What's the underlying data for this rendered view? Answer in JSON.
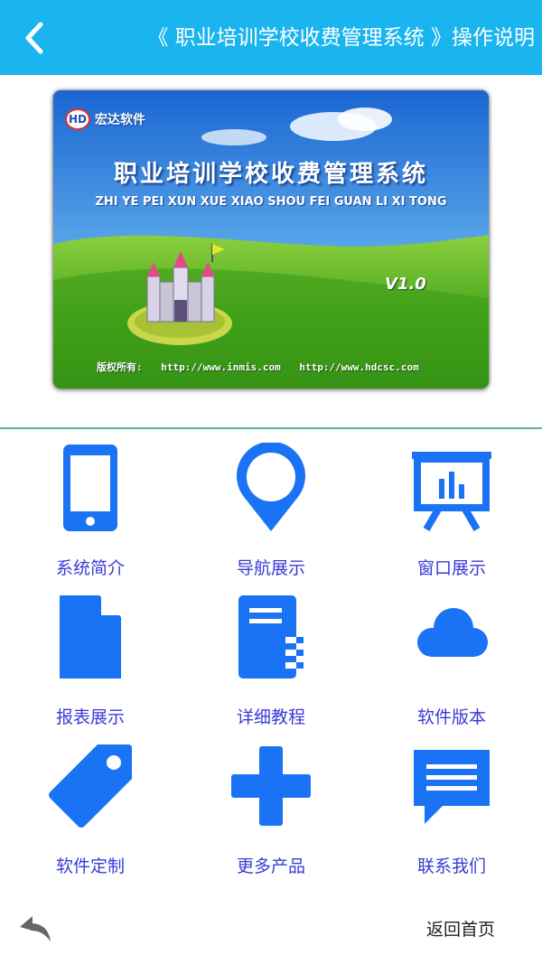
{
  "header": {
    "title": "《 职业培训学校收费管理系统 》操作说明",
    "back_icon": "chevron-left-icon",
    "background": "#1ab4ef"
  },
  "banner": {
    "company": "宏达软件",
    "logo_text": "HD",
    "title": "职业培训学校收费管理系统",
    "subtitle": "ZHI YE PEI XUN XUE XIAO SHOU FEI GUAN LI XI TONG",
    "version": "V1.0",
    "copyright_label": "版权所有:",
    "url_1": "http://www.inmis.com",
    "url_2": "http://www.hdcsc.com"
  },
  "menu": {
    "icon_color": "#1a73f5",
    "label_color": "#3a3ad6",
    "items": [
      {
        "label": "系统简介",
        "icon": "smartphone-icon"
      },
      {
        "label": "导航展示",
        "icon": "location-pin-icon"
      },
      {
        "label": "窗口展示",
        "icon": "presentation-board-icon"
      },
      {
        "label": "报表展示",
        "icon": "document-icon"
      },
      {
        "label": "详细教程",
        "icon": "notebook-icon"
      },
      {
        "label": "软件版本",
        "icon": "cloud-icon"
      },
      {
        "label": "软件定制",
        "icon": "tag-icon"
      },
      {
        "label": "更多产品",
        "icon": "plus-icon"
      },
      {
        "label": "联系我们",
        "icon": "message-icon"
      }
    ]
  },
  "footer": {
    "back_icon": "reply-arrow-icon",
    "home_label": "返回首页"
  }
}
